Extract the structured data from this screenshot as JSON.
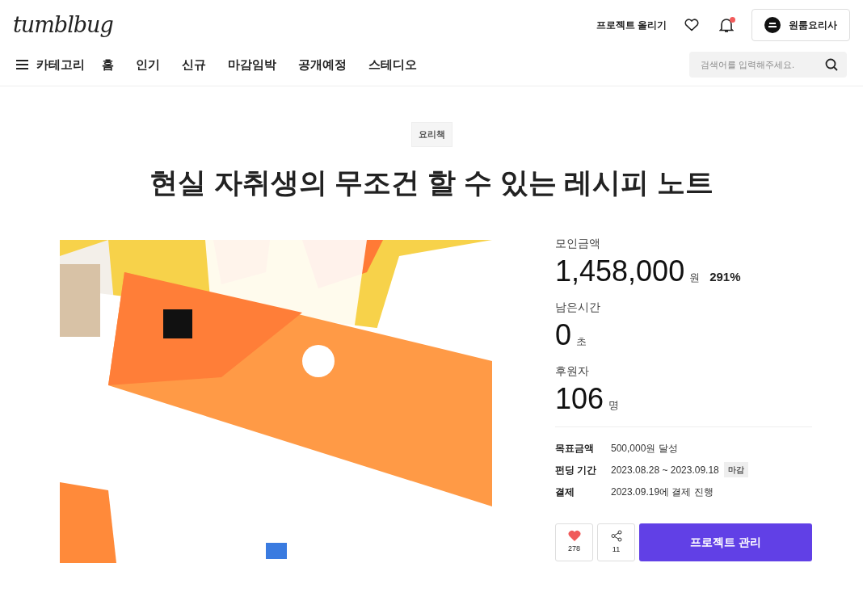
{
  "header": {
    "logo": "tumblbug",
    "upload_link": "프로젝트 올리기",
    "notifications": {
      "has_new": true
    },
    "profile": {
      "name": "원룸요리사"
    }
  },
  "nav": {
    "category_label": "카테고리",
    "items": [
      "홈",
      "인기",
      "신규",
      "마감임박",
      "공개예정",
      "스테디오"
    ],
    "search": {
      "placeholder": "검색어를 입력해주세요."
    }
  },
  "project": {
    "category": "요리책",
    "title": "현실 자취생의 무조건 할 수 있는 레시피 노트",
    "stats": [
      {
        "label": "모인금액",
        "value": "1,458,000",
        "unit": "원",
        "extra": "291%"
      },
      {
        "label": "남은시간",
        "value": "0",
        "unit": "초"
      },
      {
        "label": "후원자",
        "value": "106",
        "unit": "명"
      }
    ],
    "details": [
      {
        "label": "목표금액",
        "value": "500,000원 달성"
      },
      {
        "label": "펀딩 기간",
        "value": "2023.08.28 ~ 2023.09.18",
        "badge": "마감"
      },
      {
        "label": "결제",
        "value": "2023.09.19에 결제 진행"
      }
    ],
    "like": {
      "count": "278",
      "liked": true
    },
    "share": {
      "count": "11"
    },
    "primary_button": "프로젝트 관리"
  }
}
